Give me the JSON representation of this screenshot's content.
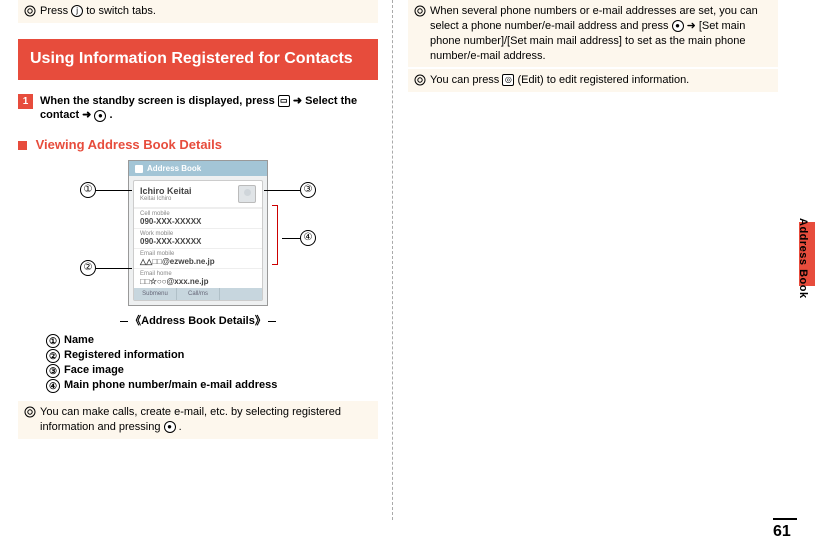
{
  "page_number": "61",
  "side_tab": "Address Book",
  "left": {
    "note_top": "Press ",
    "note_top_tail": " to switch tabs.",
    "key_press": "j",
    "section_header": "Using Information Registered for Contacts",
    "step1_prefix": "When the standby screen is displayed, press ",
    "step1_mid": " ➜ Select the contact ➜ ",
    "step1_end": ".",
    "key_contacts": "▭",
    "key_center": "●",
    "sub_heading": "Viewing Address Book Details",
    "phone": {
      "title": "Address Book",
      "name": "Ichiro Keitai",
      "reading": "Keitai Ichiro",
      "f1_label": "Cell mobile",
      "f1_value": "090-XXX-XXXXX",
      "f2_label": "Work mobile",
      "f2_value": "090-XXX-XXXXX",
      "f3_label": "Email mobile",
      "f3_value": "△△□□@ezweb.ne.jp",
      "f4_label": "Email home",
      "f4_value": "□□☆○○@xxx.ne.jp",
      "btn1": "Submenu",
      "btn2": "Call/ms",
      "btn3": " "
    },
    "caption": "《Address Book Details》",
    "legend": {
      "l1": "Name",
      "l2": "Registered information",
      "l3": "Face image",
      "l4": "Main phone number/main e-mail address"
    },
    "note_bottom_a": "You can make calls, create e-mail, etc. by selecting registered information and pressing ",
    "note_bottom_b": "."
  },
  "right": {
    "note1_a": "When several phone numbers or e-mail addresses are set, you can select a phone number/e-mail address and press ",
    "note1_b": " ➜ [Set main phone number]/[Set main mail address] to set as the main phone number/e-mail address.",
    "note2_a": "You can press ",
    "note2_b": " (Edit) to edit registered information.",
    "key_edit": "◎"
  }
}
